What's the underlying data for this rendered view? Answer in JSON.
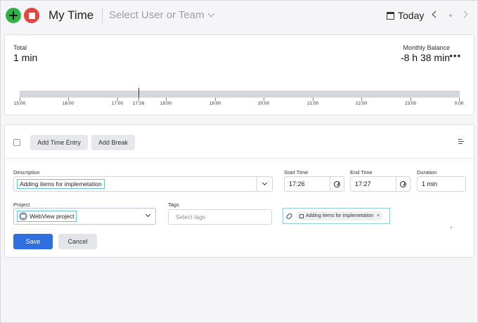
{
  "header": {
    "title": "My Time",
    "user_select_placeholder": "Select User or Team",
    "date_label": "Today"
  },
  "summary": {
    "total_label": "Total",
    "total_value": "1 min",
    "balance_label": "Monthly Balance",
    "balance_value": "-8 h 38 min",
    "more_glyph": "•••"
  },
  "timeline": {
    "ticks": [
      "15:00",
      "16:00",
      "17:00",
      "17:26",
      "18:00",
      "19:00",
      "20:00",
      "21:00",
      "22:00",
      "23:00",
      "0:00"
    ],
    "now": "17:26"
  },
  "toolbar": {
    "add_time_entry": "Add Time Entry",
    "add_break": "Add Break"
  },
  "form": {
    "description_label": "Description",
    "description_value": "Adding items for implemetation",
    "start_label": "Start Time",
    "start_value": "17:26",
    "end_label": "End Time",
    "end_value": "17:27",
    "duration_label": "Duration",
    "duration_value": "1 min",
    "project_label": "Project",
    "project_value": "WebView project",
    "tags_label": "Tags",
    "tags_placeholder": "Select tags",
    "link_chip": "Adding items for implemetation",
    "link_remove": "×",
    "save": "Save",
    "cancel": "Cancel"
  },
  "colors": {
    "add": "#2fb344",
    "stop": "#e5443f",
    "primary": "#2f6fe0",
    "focus": "#66c4d8"
  }
}
